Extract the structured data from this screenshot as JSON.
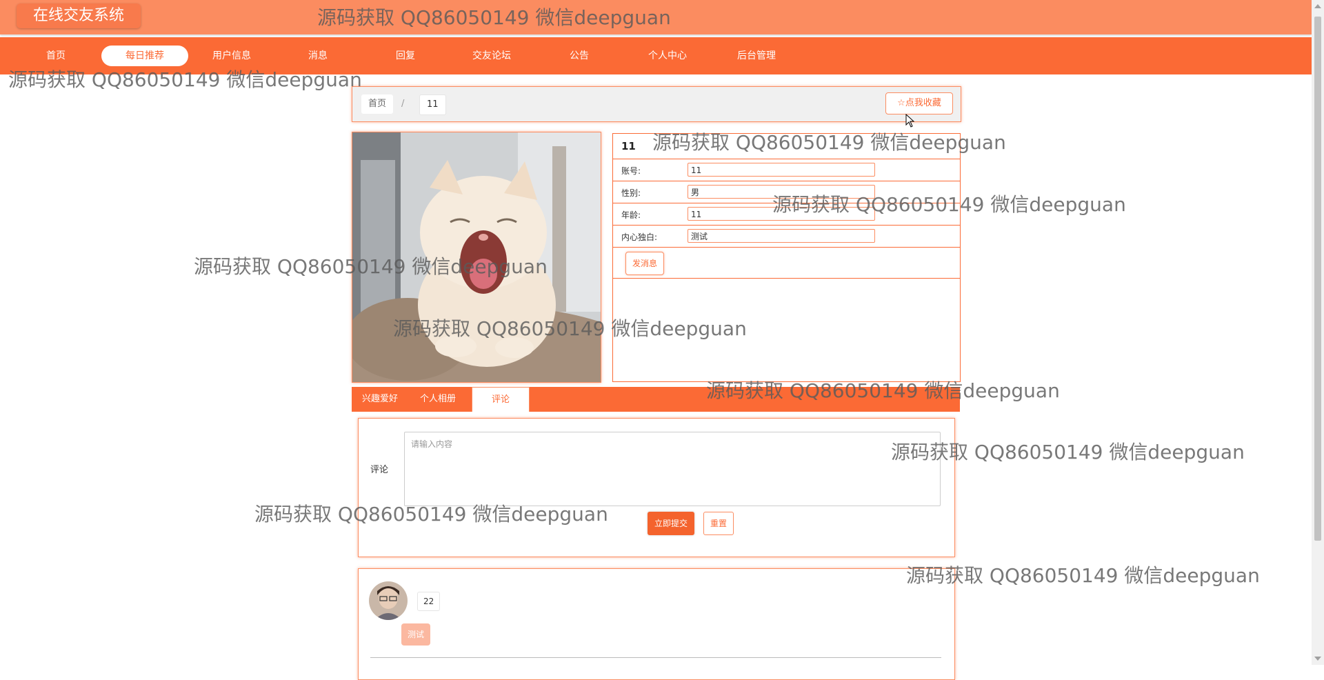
{
  "header": {
    "logo": "在线交友系统"
  },
  "nav": [
    {
      "label": "首页",
      "active": false
    },
    {
      "label": "每日推荐",
      "active": true
    },
    {
      "label": "用户信息",
      "active": false
    },
    {
      "label": "消息",
      "active": false
    },
    {
      "label": "回复",
      "active": false
    },
    {
      "label": "交友论坛",
      "active": false
    },
    {
      "label": "公告",
      "active": false
    },
    {
      "label": "个人中心",
      "active": false
    },
    {
      "label": "后台管理",
      "active": false
    }
  ],
  "breadcrumb": {
    "home": "首页",
    "separator": "/",
    "current": "11"
  },
  "favorite_button": {
    "icon": "star-outline-icon",
    "label": "点我收藏"
  },
  "profile": {
    "title": "11",
    "fields": [
      {
        "label": "账号:",
        "value": "11"
      },
      {
        "label": "性别:",
        "value": "男"
      },
      {
        "label": "年龄:",
        "value": "11"
      },
      {
        "label": "内心独白:",
        "value": "测试"
      }
    ],
    "message_button": "发消息"
  },
  "tabs": [
    {
      "label": "兴趣爱好",
      "active": false
    },
    {
      "label": "个人相册",
      "active": false
    },
    {
      "label": "评论",
      "active": true
    }
  ],
  "comment_form": {
    "label": "评论",
    "placeholder": "请输入内容",
    "submit": "立即提交",
    "reset": "重置"
  },
  "comments": [
    {
      "user": "22",
      "content": "测试"
    }
  ],
  "watermark": "源码获取 QQ86050149 微信deepguan",
  "colors": {
    "primary": "#fb6a35",
    "topbar": "#fb8c60",
    "logo_bg": "#f87a4c"
  }
}
